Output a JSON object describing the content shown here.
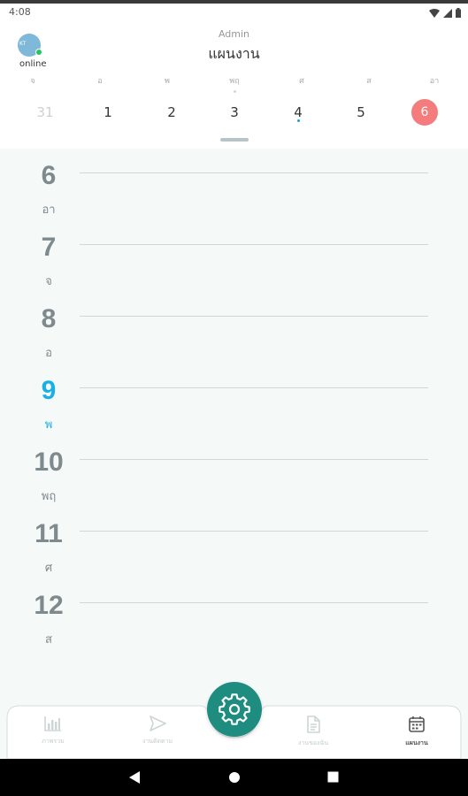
{
  "status_bar": {
    "time": "4:08"
  },
  "header": {
    "avatar_text": "KT",
    "online_label": "online",
    "role_label": "Admin",
    "title": "แผนงาน"
  },
  "week": {
    "days": [
      "จ",
      "อ",
      "พ",
      "พฤ",
      "ศ",
      "ส",
      "อา"
    ],
    "dates": [
      "31",
      "1",
      "2",
      "3",
      "4",
      "5",
      "6"
    ],
    "selected_date": "6"
  },
  "day_list": [
    {
      "number": "6",
      "name": "อา",
      "current": false
    },
    {
      "number": "7",
      "name": "จ",
      "current": false
    },
    {
      "number": "8",
      "name": "อ",
      "current": false
    },
    {
      "number": "9",
      "name": "พ",
      "current": true
    },
    {
      "number": "10",
      "name": "พฤ",
      "current": false
    },
    {
      "number": "11",
      "name": "ศ",
      "current": false
    },
    {
      "number": "12",
      "name": "ส",
      "current": false
    }
  ],
  "bottom_nav": [
    {
      "label": "ภาพรวม",
      "icon": "bar-chart-icon",
      "active": false
    },
    {
      "label": "งานติดตาม",
      "icon": "send-icon",
      "active": false
    },
    {
      "label": "งานของฉัน",
      "icon": "document-icon",
      "active": false
    },
    {
      "label": "แผนงาน",
      "icon": "calendar-icon",
      "active": true
    }
  ],
  "fab": {
    "icon": "gear-icon"
  },
  "colors": {
    "accent": "#1f8c80",
    "selected_date": "#f47c7c",
    "current_day": "#1ab0e6",
    "online": "#22c55e"
  }
}
